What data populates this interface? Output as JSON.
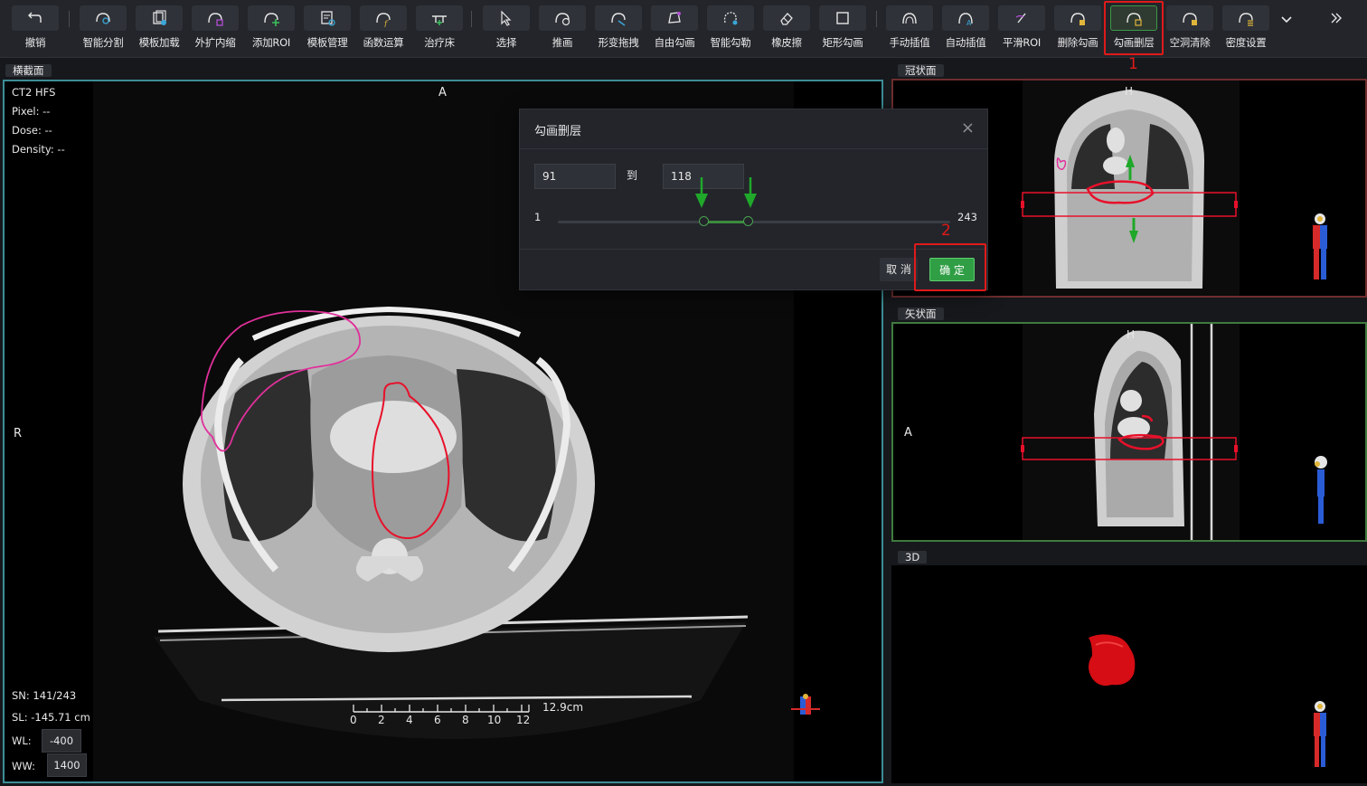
{
  "toolbar": {
    "items": [
      {
        "label": "撤销",
        "icon": "undo-icon"
      },
      {
        "label": "智能分割",
        "icon": "smart-segment-icon"
      },
      {
        "label": "模板加载",
        "icon": "template-load-icon"
      },
      {
        "label": "外扩内缩",
        "icon": "expand-shrink-icon"
      },
      {
        "label": "添加ROI",
        "icon": "add-roi-icon"
      },
      {
        "label": "模板管理",
        "icon": "template-manage-icon"
      },
      {
        "label": "函数运算",
        "icon": "function-icon"
      },
      {
        "label": "治疗床",
        "icon": "treatment-couch-icon"
      },
      {
        "label": "选择",
        "icon": "select-arrow-icon"
      },
      {
        "label": "推画",
        "icon": "push-draw-icon"
      },
      {
        "label": "形变拖拽",
        "icon": "deform-drag-icon"
      },
      {
        "label": "自由勾画",
        "icon": "free-draw-icon"
      },
      {
        "label": "智能勾勒",
        "icon": "smart-outline-icon"
      },
      {
        "label": "橡皮擦",
        "icon": "eraser-icon"
      },
      {
        "label": "矩形勾画",
        "icon": "rectangle-icon"
      },
      {
        "label": "手动插值",
        "icon": "manual-interp-icon"
      },
      {
        "label": "自动插值",
        "icon": "auto-interp-icon"
      },
      {
        "label": "平滑ROI",
        "icon": "smooth-roi-icon"
      },
      {
        "label": "删除勾画",
        "icon": "delete-contour-icon"
      },
      {
        "label": "勾画删层",
        "icon": "delete-layer-icon"
      },
      {
        "label": "空洞清除",
        "icon": "hole-clear-icon"
      },
      {
        "label": "密度设置",
        "icon": "density-icon"
      }
    ],
    "more_icon": "chevron-down-icon",
    "expand_icon": "double-chevron-right-icon"
  },
  "callouts": {
    "one": "1",
    "two": "2"
  },
  "panels": {
    "axial": {
      "title": "横截面",
      "info": {
        "line1": "CT2 HFS",
        "line2": "Pixel: --",
        "line3": "Dose: --",
        "line4": "Density: --"
      },
      "orient": {
        "top": "A",
        "left": "R"
      },
      "sn": "SN: 141/243",
      "sl": "SL: -145.71 cm",
      "wl_label": "WL:",
      "wl_value": "-400",
      "ww_label": "WW:",
      "ww_value": "1400",
      "scale": {
        "ticks": [
          "0",
          "2",
          "4",
          "6",
          "8",
          "10",
          "12"
        ],
        "length": "12.9cm"
      }
    },
    "coronal": {
      "title": "冠状面",
      "orient_top": "H"
    },
    "sagittal": {
      "title": "矢状面",
      "orient_top": "H",
      "orient_left": "A"
    },
    "view3d": {
      "title": "3D"
    }
  },
  "dialog": {
    "title": "勾画删层",
    "from_value": "91",
    "to_label": "到",
    "to_value": "118",
    "min": "1",
    "max": "243",
    "range_start": 91,
    "range_end": 118,
    "range_total": 243,
    "cancel": "取 消",
    "confirm": "确 定"
  },
  "colors": {
    "accent_red": "#e01a1a",
    "confirm_green": "#2f9e44",
    "axial_border": "#3c8d96",
    "coronal_border": "#6e2d2d",
    "sagittal_border": "#3f7a3f",
    "roi_red": "#e8102a",
    "roi_pink": "#e0309a",
    "arrow_green": "#1fa82a"
  }
}
